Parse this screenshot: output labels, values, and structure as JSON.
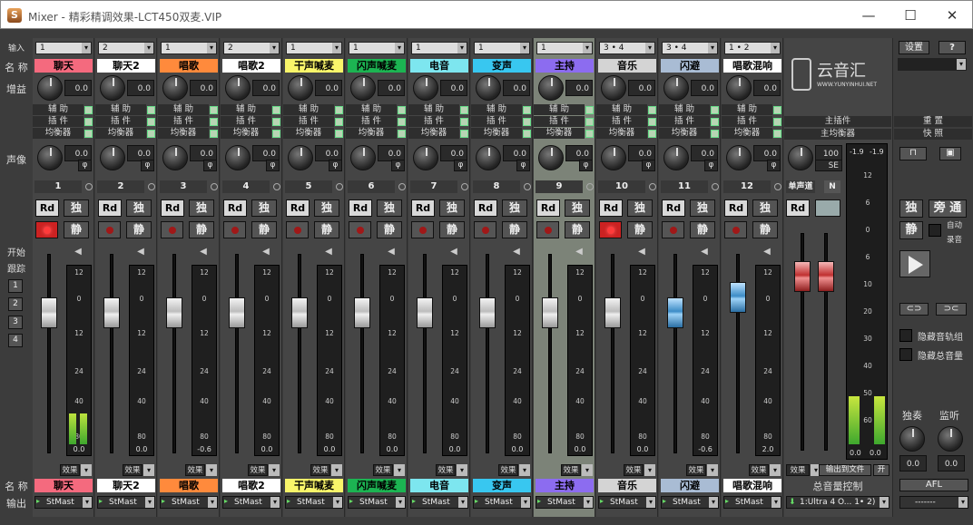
{
  "window": {
    "title": "Mixer - 精彩精调效果-LCT450双麦.VIP",
    "icon": "app-logo-icon",
    "minimize": "—",
    "maximize": "☐",
    "close": "✕"
  },
  "row_labels": {
    "input": "输入",
    "name": "名 称",
    "gain": "增益",
    "pan": "声像",
    "start": "开始",
    "follow": "跟踪",
    "bottom_name": "名 称",
    "output": "输出"
  },
  "send_labels": {
    "aux": "辅 助",
    "insert": "插 件",
    "eq": "均衡器"
  },
  "follow_buttons": [
    "1",
    "2",
    "3",
    "4"
  ],
  "channels": [
    {
      "num": "1",
      "input": "1",
      "name": "聊天",
      "color": "#f46a7e",
      "gain": "0.0",
      "pan": "0.0",
      "fader_db": "-inf",
      "meter_value": "0.0",
      "meter_level": 0.17,
      "record_on": true,
      "cap": "gray",
      "fader_pos": 0.22,
      "fx": "效果",
      "out": "StMast"
    },
    {
      "num": "2",
      "input": "2",
      "name": "聊天2",
      "color": "#ffffff",
      "gain": "0.0",
      "pan": "0.0",
      "meter_value": "0.0",
      "meter_level": 0,
      "record_on": false,
      "cap": "gray",
      "fader_pos": 0.22,
      "fx": "效果",
      "out": "StMast"
    },
    {
      "num": "3",
      "input": "1",
      "name": "唱歌",
      "color": "#ff8a3c",
      "gain": "0.0",
      "pan": "0.0",
      "meter_value": "-0.6",
      "meter_level": 0,
      "record_on": false,
      "cap": "gray",
      "fader_pos": 0.22,
      "fx": "效果",
      "out": "StMast"
    },
    {
      "num": "4",
      "input": "2",
      "name": "唱歌2",
      "color": "#ffffff",
      "gain": "0.0",
      "pan": "0.0",
      "meter_value": "0.0",
      "meter_level": 0,
      "record_on": false,
      "cap": "gray",
      "fader_pos": 0.22,
      "fx": "效果",
      "out": "StMast"
    },
    {
      "num": "5",
      "input": "1",
      "name": "干声喊麦",
      "color": "#f9f56a",
      "gain": "0.0",
      "pan": "0.0",
      "meter_value": "0.0",
      "meter_level": 0,
      "record_on": false,
      "cap": "gray",
      "fader_pos": 0.22,
      "fx": "效果",
      "out": "StMast"
    },
    {
      "num": "6",
      "input": "1",
      "name": "闪声喊麦",
      "color": "#1cb452",
      "gain": "0.0",
      "pan": "0.0",
      "meter_value": "0.0",
      "meter_level": 0,
      "record_on": false,
      "cap": "gray",
      "fader_pos": 0.22,
      "fx": "效果",
      "out": "StMast"
    },
    {
      "num": "7",
      "input": "1",
      "name": "电音",
      "color": "#7de6ef",
      "gain": "0.0",
      "pan": "0.0",
      "meter_value": "0.0",
      "meter_level": 0,
      "record_on": false,
      "cap": "gray",
      "fader_pos": 0.22,
      "fx": "效果",
      "out": "StMast"
    },
    {
      "num": "8",
      "input": "1",
      "name": "变声",
      "color": "#38c7f0",
      "gain": "0.0",
      "pan": "0.0",
      "meter_value": "0.0",
      "meter_level": 0,
      "record_on": false,
      "cap": "gray",
      "fader_pos": 0.22,
      "fx": "效果",
      "out": "StMast"
    },
    {
      "num": "9",
      "input": "1",
      "name": "主持",
      "color": "#8c6cf0",
      "gain": "0.0",
      "pan": "0.0",
      "meter_value": "0.0",
      "meter_level": 0,
      "record_on": false,
      "cap": "gray",
      "fader_pos": 0.22,
      "fx": "效果",
      "out": "StMast"
    },
    {
      "num": "10",
      "input": "3 • 4",
      "name": "音乐",
      "color": "#d4d4d4",
      "gain": "0.0",
      "pan": "0.0",
      "meter_value": "0.0",
      "meter_level": 0,
      "record_on": true,
      "cap": "gray",
      "fader_pos": 0.22,
      "fx": "效果",
      "out": "StMast"
    },
    {
      "num": "11",
      "input": "3 • 4",
      "name": "闪避",
      "color": "#a9bcd4",
      "gain": "0.0",
      "pan": "0.0",
      "meter_value": "-0.6",
      "meter_level": 0,
      "record_on": false,
      "cap": "blue",
      "fader_pos": 0.22,
      "fx": "效果",
      "out": "StMast"
    },
    {
      "num": "12",
      "input": "1 • 2",
      "name": "唱歌混响",
      "color": "#ffffff",
      "gain": "0.0",
      "pan": "0.0",
      "meter_value": "2.0",
      "meter_level": 0,
      "record_on": false,
      "cap": "blue",
      "fader_pos": 0.14,
      "fx": "效果",
      "out": "StMast"
    }
  ],
  "meter_scale": [
    "12",
    "0",
    "12",
    "24",
    "40",
    "80"
  ],
  "master": {
    "logo_text": "云音汇",
    "logo_url": "WWW.YUNYINHUI.NET",
    "insert": "主插件",
    "eq": "主均衡器",
    "pan": "100",
    "pan_mode": "SE",
    "mono": "单声道",
    "mono_n": "N",
    "rd": "Rd",
    "title": "总音量控制",
    "fx": "效果",
    "export": "输出到文件",
    "on": "开",
    "out": "1:Ultra 4 O... 1• 2)",
    "meter_tops": [
      "-1.9",
      "-1.9"
    ],
    "meter_scale": [
      "12",
      "6",
      "0",
      "6",
      "10",
      "20",
      "30",
      "40",
      "50",
      "60"
    ],
    "meter_values": [
      "0.0",
      "0.0"
    ],
    "meter_level": 0.16
  },
  "right_panel": {
    "settings": "设置",
    "help": "?",
    "reset": "重 置",
    "quick": "快 照",
    "solo": "独",
    "bypass": "旁 通",
    "mute": "静",
    "auto": "自动",
    "record": "录音",
    "hide_tracks": "隐藏音轨组",
    "hide_master": "隐藏总音量",
    "solo_knob": "独奏",
    "monitor_knob": "监听",
    "solo_val": "0.0",
    "monitor_val": "0.0",
    "afl": "AFL",
    "out": "-------"
  },
  "buttons": {
    "rd": "Rd",
    "solo": "独",
    "mute": "静",
    "fx": "效果"
  }
}
